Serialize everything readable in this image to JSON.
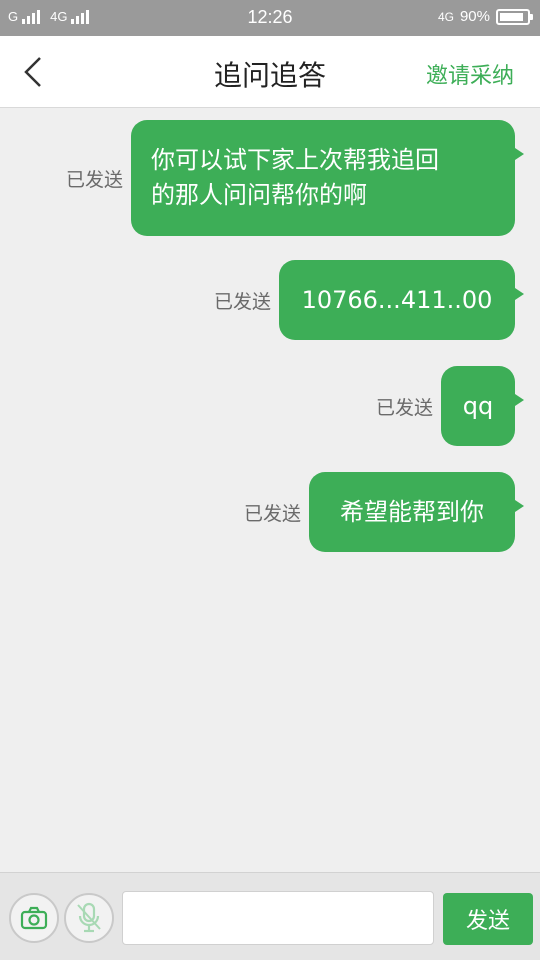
{
  "status_bar": {
    "carrier1": "G",
    "carrier2": "4G",
    "time": "12:26",
    "network": "4G",
    "battery": "90%",
    "battery_level": 0.9
  },
  "header": {
    "title": "追问追答",
    "invite_label": "邀请采纳"
  },
  "messages": [
    {
      "status": "已发送",
      "lines": [
        "你可以试下家上次帮我追回",
        "的那人问问帮你的啊"
      ]
    },
    {
      "status": "已发送",
      "lines": [
        "10766...411..00"
      ]
    },
    {
      "status": "已发送",
      "lines": [
        "qq"
      ]
    },
    {
      "status": "已发送",
      "lines": [
        "希望能帮到你"
      ]
    }
  ],
  "input": {
    "value": "",
    "placeholder": ""
  },
  "send_label": "发送",
  "colors": {
    "accent": "#3dae57",
    "background": "#efefef"
  }
}
